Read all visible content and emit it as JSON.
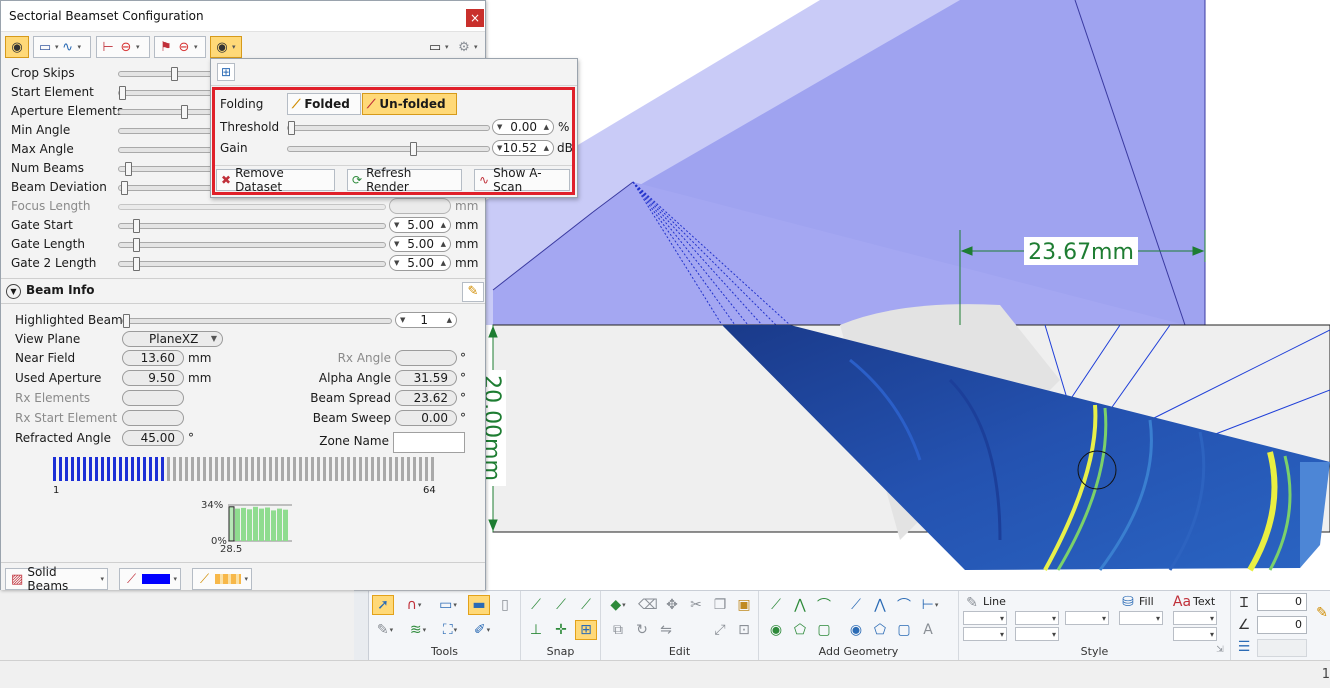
{
  "window": {
    "title": "Sectorial Beamset Configuration",
    "close_glyph": "×"
  },
  "settings": [
    {
      "label": "Crop Skips",
      "enabled": true
    },
    {
      "label": "Start Element",
      "enabled": true
    },
    {
      "label": "Aperture Elements",
      "enabled": true
    },
    {
      "label": "Min Angle",
      "enabled": true
    },
    {
      "label": "Max Angle",
      "enabled": true
    },
    {
      "label": "Num Beams",
      "enabled": true
    },
    {
      "label": "Beam Deviation",
      "enabled": true
    },
    {
      "label": "Focus Length",
      "enabled": false,
      "value": "",
      "unit": "mm"
    },
    {
      "label": "Gate Start",
      "enabled": true,
      "value": "5.00",
      "unit": "mm"
    },
    {
      "label": "Gate Length",
      "enabled": true,
      "value": "5.00",
      "unit": "mm"
    },
    {
      "label": "Gate 2 Length",
      "enabled": true,
      "value": "5.00",
      "unit": "mm"
    }
  ],
  "popup": {
    "folding_label": "Folding",
    "folded_label": "Folded",
    "unfolded_label": "Un-folded",
    "threshold_label": "Threshold",
    "threshold_value": "0.00",
    "threshold_unit": "%",
    "gain_label": "Gain",
    "gain_value": "10.52",
    "gain_unit": "dB",
    "remove_dataset": "Remove Dataset",
    "refresh_render": "Refresh Render",
    "show_ascan": "Show A-Scan"
  },
  "beam_info": {
    "title": "Beam Info",
    "highlighted_beam_label": "Highlighted Beam",
    "highlighted_beam_value": "1",
    "view_plane_label": "View Plane",
    "view_plane_value": "PlaneXZ",
    "near_field_label": "Near Field",
    "near_field_value": "13.60",
    "near_field_unit": "mm",
    "used_aperture_label": "Used Aperture",
    "used_aperture_value": "9.50",
    "used_aperture_unit": "mm",
    "rx_elements_label": "Rx Elements",
    "rx_start_element_label": "Rx Start Element",
    "refracted_angle_label": "Refracted Angle",
    "refracted_angle_value": "45.00",
    "refracted_angle_unit": "°",
    "rx_angle_label": "Rx Angle",
    "rx_angle_unit": "°",
    "alpha_angle_label": "Alpha Angle",
    "alpha_angle_value": "31.59",
    "alpha_angle_unit": "°",
    "beam_spread_label": "Beam Spread",
    "beam_spread_value": "23.62",
    "beam_spread_unit": "°",
    "beam_sweep_label": "Beam Sweep",
    "beam_sweep_value": "0.00",
    "beam_sweep_unit": "°",
    "zone_name_label": "Zone Name",
    "zone_name_value": ""
  },
  "elements": {
    "total": 64,
    "active": 19,
    "first_label": "1",
    "last_label": "64",
    "active_color": "#1c2fd6",
    "inactive_color": "#a9a9a9"
  },
  "mini_chart": {
    "top_label": "34%",
    "bottom_label": "0%",
    "x_label": "28.5",
    "bars": [
      0.95,
      0.9,
      0.92,
      0.88,
      0.95,
      0.9,
      0.93,
      0.85,
      0.9,
      0.87
    ],
    "bar_color": "#8fdc8f",
    "first_bar_color": "#b7e7b7"
  },
  "footer": {
    "solid_beams_label": "Solid Beams",
    "line_color": "#0000ff"
  },
  "viewport": {
    "dimension_horizontal": "23.67mm",
    "dimension_vertical": "20.00mm",
    "dimension_color": "#1e7d32"
  },
  "ribbon": {
    "groups": [
      "Tools",
      "Snap",
      "Edit",
      "Add Geometry",
      "Style"
    ],
    "line_label": "Line",
    "fill_label": "Fill",
    "text_label": "Text",
    "field_1": "0",
    "field_2": "0",
    "status_right": "1"
  }
}
